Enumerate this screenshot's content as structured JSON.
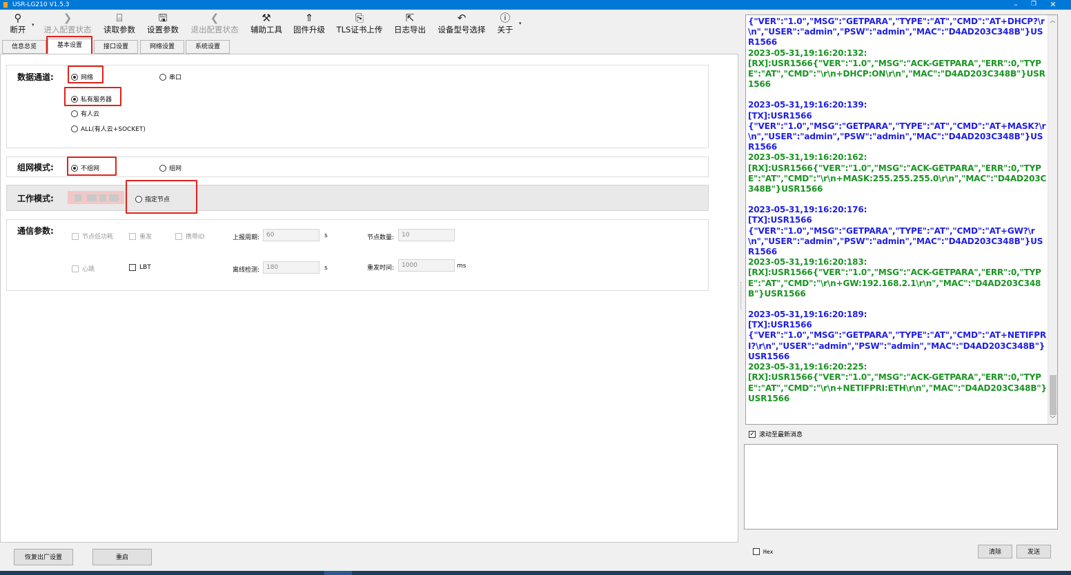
{
  "window": {
    "title": "USR-LG210 V1.5.3",
    "minimize": "–",
    "restore": "❐",
    "close": "✕"
  },
  "toolbar": {
    "items": [
      {
        "label": "断开",
        "icon": "⚲",
        "icon_name": "disconnect-icon",
        "enabled": true
      },
      {
        "label": "进入配置状态",
        "icon": "❯",
        "icon_name": "chevron-right-icon",
        "enabled": false
      },
      {
        "label": "读取参数",
        "icon": "⌸",
        "icon_name": "read-params-icon",
        "enabled": true
      },
      {
        "label": "设置参数",
        "icon": "🖫",
        "icon_name": "save-icon",
        "enabled": true
      },
      {
        "label": "退出配置状态",
        "icon": "❮",
        "icon_name": "chevron-left-icon",
        "enabled": false
      },
      {
        "label": "辅助工具",
        "icon": "⚒",
        "icon_name": "toolbox-icon",
        "enabled": true
      },
      {
        "label": "固件升级",
        "icon": "⇑",
        "icon_name": "firmware-upgrade-icon",
        "enabled": true
      },
      {
        "label": "TLS证书上传",
        "icon": "⎘",
        "icon_name": "certificate-icon",
        "enabled": true
      },
      {
        "label": "日志导出",
        "icon": "⇱",
        "icon_name": "export-icon",
        "enabled": true
      },
      {
        "label": "设备型号选择",
        "icon": "↶",
        "icon_name": "undo-arrow-icon",
        "enabled": true
      },
      {
        "label": "关于",
        "icon": "ⓘ",
        "icon_name": "info-icon",
        "enabled": true
      }
    ],
    "dropdown_arrow": "▾"
  },
  "tabs": [
    "信息总览",
    "基本设置",
    "接口设置",
    "网络设置",
    "系统设置"
  ],
  "active_tab": "基本设置",
  "data_channel": {
    "label": "数据通道:",
    "options": [
      "网络",
      "串口"
    ],
    "selected": "网络",
    "server_options": [
      "私有服务器",
      "有人云",
      "ALL(有人云+SOCKET)"
    ],
    "server_selected": "私有服务器"
  },
  "network_mode": {
    "label": "组网模式:",
    "options": [
      "不组网",
      "组网"
    ],
    "selected": "不组网"
  },
  "work_mode": {
    "label": "工作模式:",
    "option": "指定节点"
  },
  "comm_params": {
    "label": "通信参数:",
    "checkboxes": [
      {
        "label": "节点低功耗",
        "checked": false,
        "enabled": false
      },
      {
        "label": "重发",
        "checked": false,
        "enabled": false
      },
      {
        "label": "携带ID",
        "checked": false,
        "enabled": false
      },
      {
        "label": "心跳",
        "checked": false,
        "enabled": false
      },
      {
        "label": "LBT",
        "checked": false,
        "enabled": true
      }
    ],
    "report_period_label": "上报周期:",
    "report_period_value": "60",
    "report_period_unit": "s",
    "node_count_label": "节点数量:",
    "node_count_value": "10",
    "offline_detect_label": "离线检测:",
    "offline_detect_value": "180",
    "offline_detect_unit": "s",
    "resend_time_label": "重发时间:",
    "resend_time_value": "1000",
    "resend_time_unit": "ms"
  },
  "bottom_buttons": {
    "factory_reset": "恢复出厂设置",
    "restart": "重启"
  },
  "log": {
    "entries": [
      {
        "type": "tx",
        "text": "{\"VER\":\"1.0\",\"MSG\":\"GETPARA\",\"TYPE\":\"AT\",\"CMD\":\"AT+DHCP?\\r\\n\",\"USER\":\"admin\",\"PSW\":\"admin\",\"MAC\":\"D4AD203C348B\"}USR1566",
        "gap_after": false
      },
      {
        "type": "rx",
        "text": "2023-05-31,19:16:20:132:\n[RX]:USR1566{\"VER\":\"1.0\",\"MSG\":\"ACK-GETPARA\",\"ERR\":0,\"TYPE\":\"AT\",\"CMD\":\"\\r\\n+DHCP:ON\\r\\n\",\"MAC\":\"D4AD203C348B\"}USR1566",
        "gap_after": true
      },
      {
        "type": "tx",
        "text": "2023-05-31,19:16:20:139:\n[TX]:USR1566\n{\"VER\":\"1.0\",\"MSG\":\"GETPARA\",\"TYPE\":\"AT\",\"CMD\":\"AT+MASK?\\r\\n\",\"USER\":\"admin\",\"PSW\":\"admin\",\"MAC\":\"D4AD203C348B\"}USR1566",
        "gap_after": false
      },
      {
        "type": "rx",
        "text": "2023-05-31,19:16:20:162:\n[RX]:USR1566{\"VER\":\"1.0\",\"MSG\":\"ACK-GETPARA\",\"ERR\":0,\"TYPE\":\"AT\",\"CMD\":\"\\r\\n+MASK:255.255.255.0\\r\\n\",\"MAC\":\"D4AD203C348B\"}USR1566",
        "gap_after": true
      },
      {
        "type": "tx",
        "text": "2023-05-31,19:16:20:176:\n[TX]:USR1566\n{\"VER\":\"1.0\",\"MSG\":\"GETPARA\",\"TYPE\":\"AT\",\"CMD\":\"AT+GW?\\r\\n\",\"USER\":\"admin\",\"PSW\":\"admin\",\"MAC\":\"D4AD203C348B\"}USR1566",
        "gap_after": false
      },
      {
        "type": "rx",
        "text": "2023-05-31,19:16:20:183:\n[RX]:USR1566{\"VER\":\"1.0\",\"MSG\":\"ACK-GETPARA\",\"ERR\":0,\"TYPE\":\"AT\",\"CMD\":\"\\r\\n+GW:192.168.2.1\\r\\n\",\"MAC\":\"D4AD203C348B\"}USR1566",
        "gap_after": true
      },
      {
        "type": "tx",
        "text": "2023-05-31,19:16:20:189:\n[TX]:USR1566\n{\"VER\":\"1.0\",\"MSG\":\"GETPARA\",\"TYPE\":\"AT\",\"CMD\":\"AT+NETIFPRI?\\r\\n\",\"USER\":\"admin\",\"PSW\":\"admin\",\"MAC\":\"D4AD203C348B\"}USR1566",
        "gap_after": false
      },
      {
        "type": "rx",
        "text": "2023-05-31,19:16:20:225:\n[RX]:USR1566{\"VER\":\"1.0\",\"MSG\":\"ACK-GETPARA\",\"ERR\":0,\"TYPE\":\"AT\",\"CMD\":\"\\r\\n+NETIFPRI:ETH\\r\\n\",\"MAC\":\"D4AD203C348B\"}USR1566",
        "gap_after": false
      }
    ],
    "colors": {
      "tx": "#1f1fe6",
      "rx": "#1b9424"
    }
  },
  "scroll_to_latest": {
    "label": "滚动至最新消息",
    "checked": true
  },
  "hex": {
    "label": "Hex",
    "checked": false
  },
  "send_buttons": {
    "clear": "清除",
    "send": "发送"
  },
  "colors": {
    "titlebar": "#0078d7",
    "highlight_box": "#e0201a"
  }
}
